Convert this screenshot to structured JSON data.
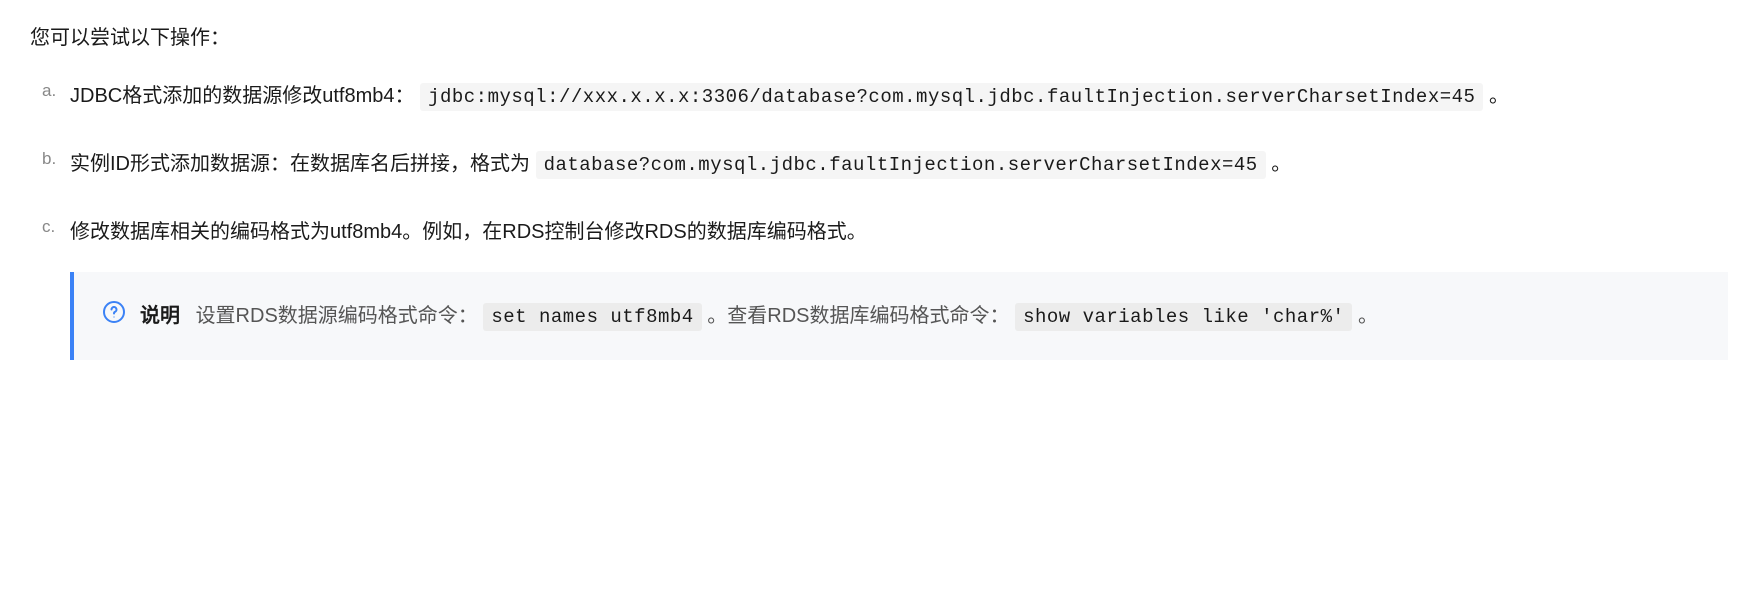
{
  "intro": "您可以尝试以下操作：",
  "items": [
    {
      "marker": "a.",
      "text_before": "JDBC格式添加的数据源修改utf8mb4：",
      "code": "jdbc:mysql://xxx.x.x.x:3306/database?com.mysql.jdbc.faultInjection.serverCharsetIndex=45",
      "text_after": "。"
    },
    {
      "marker": "b.",
      "text_before": "实例ID形式添加数据源：在数据库名后拼接，格式为",
      "code": "database?com.mysql.jdbc.faultInjection.serverCharsetIndex=45",
      "text_after": "。"
    },
    {
      "marker": "c.",
      "text_before": "修改数据库相关的编码格式为utf8mb4。例如，在RDS控制台修改RDS的数据库编码格式。",
      "code": "",
      "text_after": ""
    }
  ],
  "note": {
    "label": "说明",
    "part1": "设置RDS数据源编码格式命令：",
    "code1": "set names utf8mb4",
    "part2": "。查看RDS数据库编码格式命令：",
    "code2": "show variables like 'char%'",
    "part3": "。"
  }
}
